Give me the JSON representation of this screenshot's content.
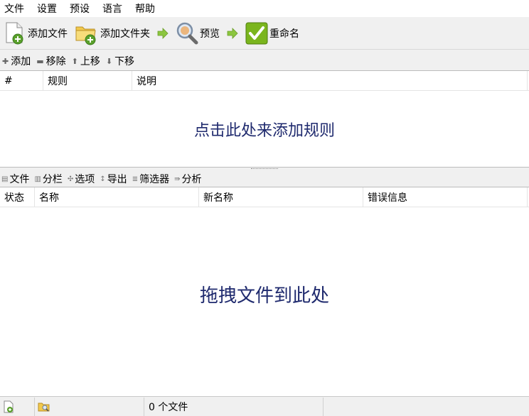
{
  "menu": [
    "文件",
    "设置",
    "预设",
    "语言",
    "帮助"
  ],
  "toolbar": {
    "add_files": "添加文件",
    "add_folder": "添加文件夹",
    "preview": "预览",
    "rename": "重命名"
  },
  "rules_toolbar": {
    "add": "添加",
    "remove": "移除",
    "move_up": "上移",
    "move_down": "下移"
  },
  "rules_table": {
    "columns": [
      "#",
      "规则",
      "说明"
    ],
    "empty_hint": "点击此处来添加规则"
  },
  "files_toolbar": {
    "files": "文件",
    "columns": "分栏",
    "options": "选项",
    "export": "导出",
    "filters": "筛选器",
    "analyze": "分析"
  },
  "files_table": {
    "columns": [
      "状态",
      "名称",
      "新名称",
      "错误信息"
    ],
    "empty_hint": "拖拽文件到此处"
  },
  "status": {
    "file_count": "0 个文件"
  },
  "colors": {
    "hint_text": "#1f2a6e",
    "rename_green": "#7ab51d",
    "arrow_green": "#8cc63f",
    "folder_yellow": "#f2c94c"
  }
}
